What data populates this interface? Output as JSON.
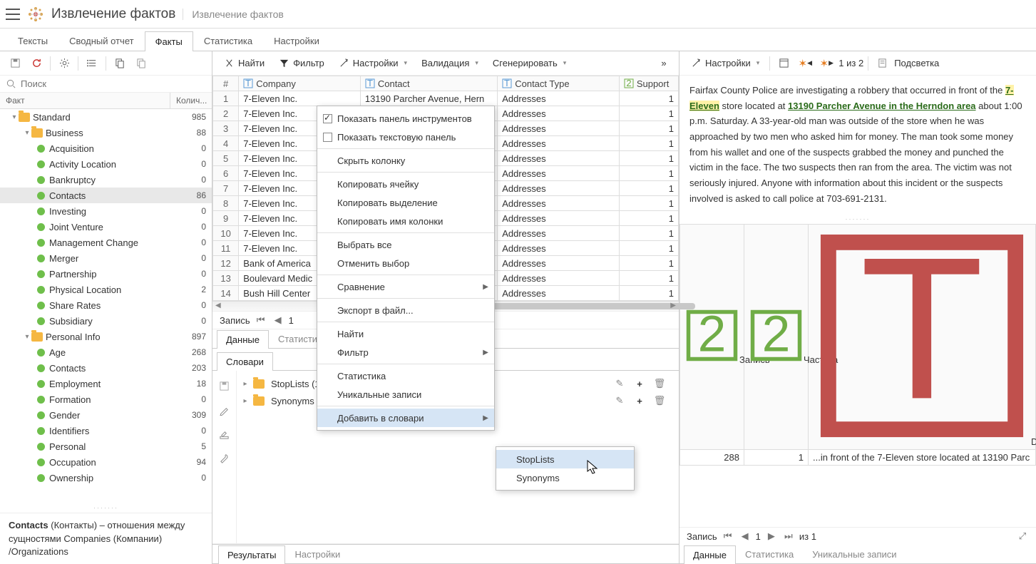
{
  "header": {
    "title": "Извлечение фактов",
    "subtitle": "Извлечение фактов"
  },
  "top_tabs": [
    "Тексты",
    "Сводный отчет",
    "Факты",
    "Статистика",
    "Настройки"
  ],
  "top_tabs_active": 2,
  "left": {
    "search_placeholder": "Поиск",
    "col_fact": "Факт",
    "col_count": "Колич...",
    "tree": [
      {
        "lvl": 0,
        "type": "folder",
        "label": "Standard",
        "count": 985,
        "open": true
      },
      {
        "lvl": 1,
        "type": "folder",
        "label": "Business",
        "count": 88,
        "open": true
      },
      {
        "lvl": 2,
        "type": "leaf",
        "label": "Acquisition",
        "count": 0
      },
      {
        "lvl": 2,
        "type": "leaf",
        "label": "Activity Location",
        "count": 0
      },
      {
        "lvl": 2,
        "type": "leaf",
        "label": "Bankruptcy",
        "count": 0
      },
      {
        "lvl": 2,
        "type": "leaf",
        "label": "Contacts",
        "count": 86,
        "selected": true
      },
      {
        "lvl": 2,
        "type": "leaf",
        "label": "Investing",
        "count": 0
      },
      {
        "lvl": 2,
        "type": "leaf",
        "label": "Joint Venture",
        "count": 0
      },
      {
        "lvl": 2,
        "type": "leaf",
        "label": "Management Change",
        "count": 0
      },
      {
        "lvl": 2,
        "type": "leaf",
        "label": "Merger",
        "count": 0
      },
      {
        "lvl": 2,
        "type": "leaf",
        "label": "Partnership",
        "count": 0
      },
      {
        "lvl": 2,
        "type": "leaf",
        "label": "Physical Location",
        "count": 2
      },
      {
        "lvl": 2,
        "type": "leaf",
        "label": "Share Rates",
        "count": 0
      },
      {
        "lvl": 2,
        "type": "leaf",
        "label": "Subsidiary",
        "count": 0
      },
      {
        "lvl": 1,
        "type": "folder",
        "label": "Personal Info",
        "count": 897,
        "open": true
      },
      {
        "lvl": 2,
        "type": "leaf",
        "label": "Age",
        "count": 268
      },
      {
        "lvl": 2,
        "type": "leaf",
        "label": "Contacts",
        "count": 203
      },
      {
        "lvl": 2,
        "type": "leaf",
        "label": "Employment",
        "count": 18
      },
      {
        "lvl": 2,
        "type": "leaf",
        "label": "Formation",
        "count": 0
      },
      {
        "lvl": 2,
        "type": "leaf",
        "label": "Gender",
        "count": 309
      },
      {
        "lvl": 2,
        "type": "leaf",
        "label": "Identifiers",
        "count": 0
      },
      {
        "lvl": 2,
        "type": "leaf",
        "label": "Personal",
        "count": 5
      },
      {
        "lvl": 2,
        "type": "leaf",
        "label": "Occupation",
        "count": 94
      },
      {
        "lvl": 2,
        "type": "leaf",
        "label": "Ownership",
        "count": 0
      }
    ],
    "desc_bold": "Contacts",
    "desc_text": " (Контакты) – отношения между сущностями Companies (Компании) /Organizations"
  },
  "center": {
    "toolbar": {
      "find": "Найти",
      "filter": "Фильтр",
      "settings": "Настройки",
      "validation": "Валидация",
      "generate": "Сгенерировать"
    },
    "columns": [
      "#",
      "Company",
      "Contact",
      "Contact Type",
      "Support"
    ],
    "rows": [
      {
        "n": 1,
        "company": "7-Eleven Inc.",
        "contact": "13190 Parcher Avenue, Hern",
        "type": "Addresses",
        "support": 1
      },
      {
        "n": 2,
        "company": "7-Eleven Inc.",
        "contact": "",
        "type": "Addresses",
        "support": 1
      },
      {
        "n": 3,
        "company": "7-Eleven Inc.",
        "contact": "",
        "type": "Addresses",
        "support": 1
      },
      {
        "n": 4,
        "company": "7-Eleven Inc.",
        "contact": "",
        "type": "Addresses",
        "support": 1
      },
      {
        "n": 5,
        "company": "7-Eleven Inc.",
        "contact": "",
        "type": "Addresses",
        "support": 1
      },
      {
        "n": 6,
        "company": "7-Eleven Inc.",
        "contact": "",
        "type": "Addresses",
        "support": 1
      },
      {
        "n": 7,
        "company": "7-Eleven Inc.",
        "contact": "",
        "type": "Addresses",
        "support": 1
      },
      {
        "n": 8,
        "company": "7-Eleven Inc.",
        "contact": "",
        "type": "Addresses",
        "support": 1
      },
      {
        "n": 9,
        "company": "7-Eleven Inc.",
        "contact": "",
        "type": "Addresses",
        "support": 1
      },
      {
        "n": 10,
        "company": "7-Eleven Inc.",
        "contact": "",
        "type": "Addresses",
        "support": 1
      },
      {
        "n": 11,
        "company": "7-Eleven Inc.",
        "contact": "",
        "type": "Addresses",
        "support": 1
      },
      {
        "n": 12,
        "company": "Bank of America",
        "contact": "",
        "type": "Addresses",
        "support": 1
      },
      {
        "n": 13,
        "company": "Boulevard Medic",
        "contact": "",
        "type": "Addresses",
        "support": 1
      },
      {
        "n": 14,
        "company": "Bush Hill Center",
        "contact": "",
        "type": "Addresses",
        "support": 1
      }
    ],
    "record_label": "Запись",
    "record_value": "1",
    "sub_tabs": [
      "Данные",
      "Статистика"
    ],
    "dict_tab": "Словари",
    "dicts": [
      {
        "label": "StopLists (1)"
      },
      {
        "label": "Synonyms"
      }
    ],
    "bottom_tabs": [
      "Результаты",
      "Настройки"
    ]
  },
  "context_menu": {
    "show_toolbar": "Показать панель инструментов",
    "show_text_panel": "Показать текстовую панель",
    "hide_column": "Скрыть колонку",
    "copy_cell": "Копировать ячейку",
    "copy_selection": "Копировать выделение",
    "copy_colname": "Копировать имя колонки",
    "select_all": "Выбрать все",
    "deselect": "Отменить выбор",
    "compare": "Сравнение",
    "export": "Экспорт в файл...",
    "find": "Найти",
    "filter": "Фильтр",
    "stats": "Статистика",
    "unique": "Уникальные записи",
    "add_dict": "Добавить в словари",
    "sub_stoplists": "StopLists",
    "sub_synonyms": "Synonyms"
  },
  "right": {
    "settings": "Настройки",
    "paging": "1 из 2",
    "highlight": "Подсветка",
    "text_pre": "Fairfax County Police are investigating a robbery that occurred in front of the ",
    "text_hl1": "7-Eleven",
    "text_mid1": " store located at ",
    "text_hl2": "13190 Parcher Avenue in the Herndon area",
    "text_post": " about 1:00 p.m. Saturday. A 33-year-old man was outside of the store when he was approached by two men who asked him for money. The man took some money from his wallet and one of the suspects grabbed the money and punched the victim in the face. The two suspects then ran from the area. The victim was not seriously injured. Anyone with information about this incident or the suspects involved is asked to call police at 703-691-2131.",
    "grid_cols": [
      "Запись",
      "Частота",
      "Description"
    ],
    "grid_row": {
      "record": 288,
      "freq": 1,
      "desc_pre": "...in front of the ",
      "desc_hl": "7-Eleven",
      "desc_mid": " store located at ",
      "desc_hl2": "13190 Parc"
    },
    "nav_label": "Запись",
    "nav_val": "1",
    "nav_of": "из 1",
    "tabs": [
      "Данные",
      "Статистика",
      "Уникальные записи"
    ]
  }
}
